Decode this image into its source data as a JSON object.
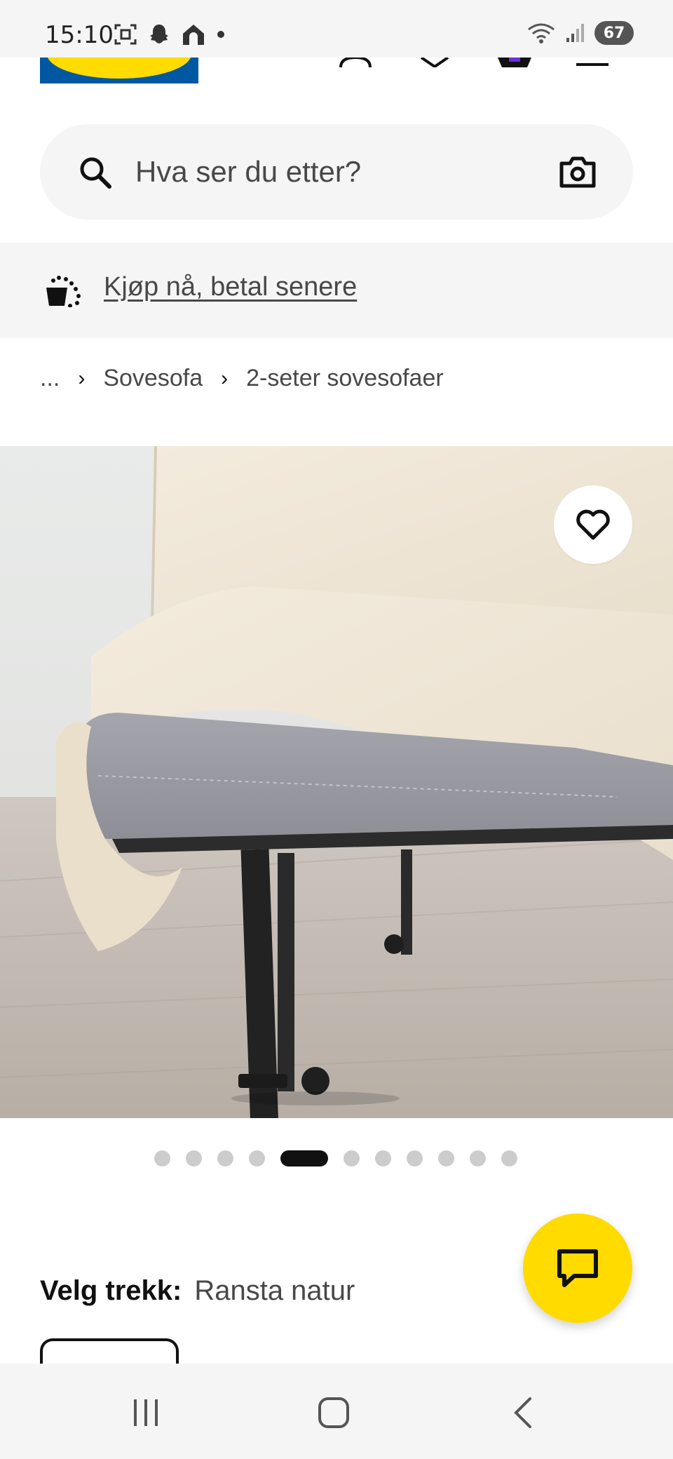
{
  "status_bar": {
    "time": "15:10",
    "battery": "67",
    "icons_left": [
      "screenshot-icon",
      "snapchat-icon",
      "home-app-icon",
      "dot-icon"
    ],
    "icons_right": [
      "wifi-icon",
      "signal-icon",
      "battery-icon"
    ]
  },
  "search": {
    "placeholder": "Hva ser du etter?"
  },
  "pay_banner": {
    "link": "Kjøp nå, betal senere"
  },
  "breadcrumb": {
    "ellipsis": "...",
    "items": [
      "Sovesofa",
      "2-seter sovesofaer"
    ]
  },
  "carousel": {
    "total": 11,
    "active_index": 5
  },
  "variant": {
    "label": "Velg trekk:",
    "value": "Ransta natur"
  },
  "colors": {
    "accent_yellow": "#ffdb00",
    "brand_blue": "#0058a3",
    "panel_gray": "#f5f5f5",
    "text_dark": "#111111",
    "text_muted": "#484848"
  }
}
